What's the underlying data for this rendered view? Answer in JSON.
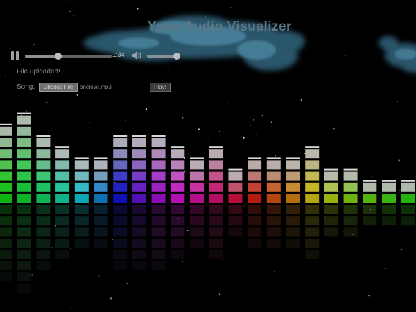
{
  "app": {
    "title": "Yuan Audio Visualizer"
  },
  "player": {
    "state": "playing",
    "pause_icon": "pause-icon",
    "volume_icon": "speaker-icon",
    "time": "1:34",
    "seek_progress": 0.38,
    "volume_level": 0.9
  },
  "upload": {
    "status": "File uploaded!",
    "song_label": "Song:",
    "choose_button": "Choose File",
    "file_name": "onelove.mp3",
    "play_button": "Play!"
  },
  "visualizer": {
    "bar_levels": [
      7,
      8,
      6,
      5,
      4,
      4,
      6,
      6,
      6,
      5,
      4,
      5,
      3,
      4,
      4,
      4,
      5,
      3,
      3,
      2,
      2,
      2
    ],
    "bar_hues": [
      120,
      130,
      145,
      165,
      185,
      205,
      240,
      265,
      285,
      300,
      315,
      330,
      345,
      5,
      20,
      35,
      55,
      70,
      85,
      95,
      105,
      112
    ],
    "max_level": 8,
    "reflection": true
  },
  "colors": {
    "background": "#000000",
    "cloud": "#4a8aa8",
    "title": "#5d7784"
  }
}
